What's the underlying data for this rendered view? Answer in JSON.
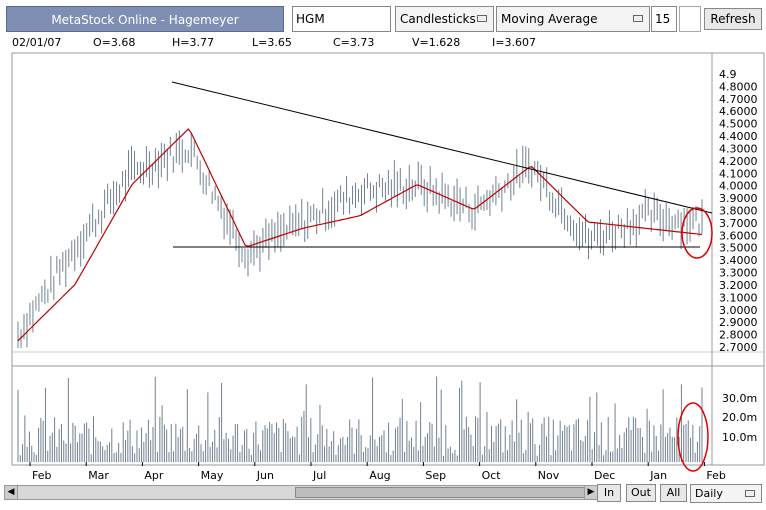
{
  "title": "MetaStock Online - Hagemeyer",
  "symbol": "HGM",
  "chart_style": "Candlesticks",
  "indicator": "Moving Average",
  "period": "15",
  "refresh_label": "Refresh",
  "quote": {
    "date": "02/01/07",
    "open": "O=3.68",
    "high": "H=3.77",
    "low": "L=3.65",
    "close": "C=3.73",
    "volume": "V=1.628",
    "indicator": "I=3.607"
  },
  "zoom_in_label": "In",
  "zoom_out_label": "Out",
  "all_label": "All",
  "interval": "Daily",
  "colors": {
    "price": "#708090",
    "moving_average": "#c00000",
    "trendline": "#000000",
    "highlight": "#e00000",
    "title_bg": "#7f8fb3"
  },
  "chart_data": [
    {
      "type": "line",
      "x": [
        "Feb",
        "Mar",
        "Apr",
        "May",
        "Jun",
        "Jul",
        "Aug",
        "Sep",
        "Oct",
        "Nov",
        "Dec",
        "Jan",
        "Feb"
      ],
      "series": [
        {
          "values": [
            2.8,
            3.5,
            4.1,
            4.3,
            3.45,
            3.7,
            3.95,
            4.0,
            3.8,
            4.15,
            3.55,
            3.75,
            3.7
          ]
        },
        {
          "values": [
            2.75,
            3.2,
            4.0,
            4.45,
            3.5,
            3.65,
            3.75,
            4.0,
            3.8,
            4.15,
            3.7,
            3.65,
            3.6
          ]
        }
      ],
      "ylim": [
        2.7,
        4.9
      ],
      "yticks": [
        "4.9",
        "4.8000",
        "4.7000",
        "4.6000",
        "4.5000",
        "4.4000",
        "4.3000",
        "4.2000",
        "4.1000",
        "4.0000",
        "3.9000",
        "3.8000",
        "3.7000",
        "3.6000",
        "3.5000",
        "3.4000",
        "3.3000",
        "3.2000",
        "3.1000",
        "3.0000",
        "2.9000",
        "2.8000",
        "2.7000"
      ]
    },
    {
      "type": "bar",
      "yticks": [
        "30.0m",
        "20.0m",
        "10.0m"
      ]
    }
  ]
}
